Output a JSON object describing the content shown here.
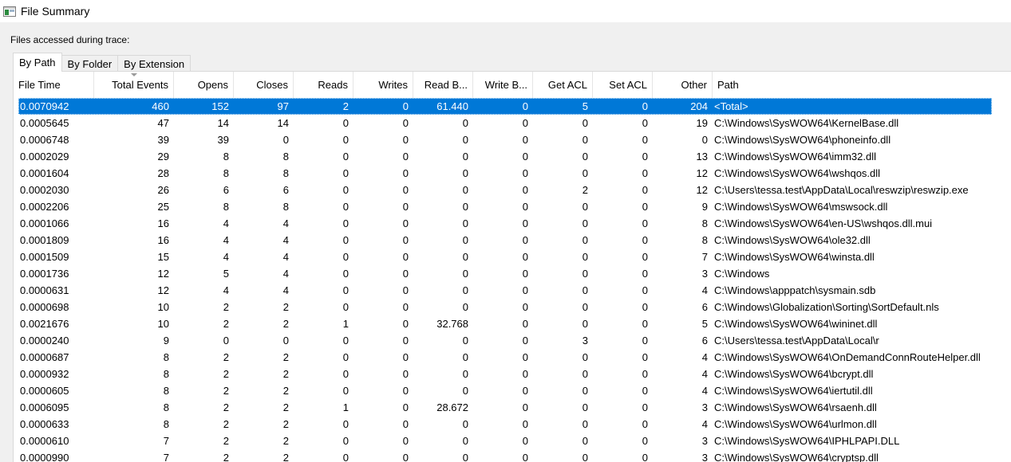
{
  "window": {
    "title": "File Summary",
    "icon": "window-app-icon"
  },
  "caption": "Files accessed during trace:",
  "tabs": [
    {
      "label": "By Path",
      "active": true
    },
    {
      "label": "By Folder",
      "active": false
    },
    {
      "label": "By Extension",
      "active": false
    }
  ],
  "columns": [
    "File Time",
    "Total Events",
    "Opens",
    "Closes",
    "Reads",
    "Writes",
    "Read B...",
    "Write B...",
    "Get ACL",
    "Set ACL",
    "Other",
    "Path"
  ],
  "colors": {
    "selection": "#0078d7"
  },
  "rows": [
    [
      "0.0070942",
      "460",
      "152",
      "97",
      "2",
      "0",
      "61.440",
      "0",
      "5",
      "0",
      "204",
      "<Total>"
    ],
    [
      "0.0005645",
      "47",
      "14",
      "14",
      "0",
      "0",
      "0",
      "0",
      "0",
      "0",
      "19",
      "C:\\Windows\\SysWOW64\\KernelBase.dll"
    ],
    [
      "0.0006748",
      "39",
      "39",
      "0",
      "0",
      "0",
      "0",
      "0",
      "0",
      "0",
      "0",
      "C:\\Windows\\SysWOW64\\phoneinfo.dll"
    ],
    [
      "0.0002029",
      "29",
      "8",
      "8",
      "0",
      "0",
      "0",
      "0",
      "0",
      "0",
      "13",
      "C:\\Windows\\SysWOW64\\imm32.dll"
    ],
    [
      "0.0001604",
      "28",
      "8",
      "8",
      "0",
      "0",
      "0",
      "0",
      "0",
      "0",
      "12",
      "C:\\Windows\\SysWOW64\\wshqos.dll"
    ],
    [
      "0.0002030",
      "26",
      "6",
      "6",
      "0",
      "0",
      "0",
      "0",
      "2",
      "0",
      "12",
      "C:\\Users\\tessa.test\\AppData\\Local\\reswzip\\reswzip.exe"
    ],
    [
      "0.0002206",
      "25",
      "8",
      "8",
      "0",
      "0",
      "0",
      "0",
      "0",
      "0",
      "9",
      "C:\\Windows\\SysWOW64\\mswsock.dll"
    ],
    [
      "0.0001066",
      "16",
      "4",
      "4",
      "0",
      "0",
      "0",
      "0",
      "0",
      "0",
      "8",
      "C:\\Windows\\SysWOW64\\en-US\\wshqos.dll.mui"
    ],
    [
      "0.0001809",
      "16",
      "4",
      "4",
      "0",
      "0",
      "0",
      "0",
      "0",
      "0",
      "8",
      "C:\\Windows\\SysWOW64\\ole32.dll"
    ],
    [
      "0.0001509",
      "15",
      "4",
      "4",
      "0",
      "0",
      "0",
      "0",
      "0",
      "0",
      "7",
      "C:\\Windows\\SysWOW64\\winsta.dll"
    ],
    [
      "0.0001736",
      "12",
      "5",
      "4",
      "0",
      "0",
      "0",
      "0",
      "0",
      "0",
      "3",
      "C:\\Windows"
    ],
    [
      "0.0000631",
      "12",
      "4",
      "4",
      "0",
      "0",
      "0",
      "0",
      "0",
      "0",
      "4",
      "C:\\Windows\\apppatch\\sysmain.sdb"
    ],
    [
      "0.0000698",
      "10",
      "2",
      "2",
      "0",
      "0",
      "0",
      "0",
      "0",
      "0",
      "6",
      "C:\\Windows\\Globalization\\Sorting\\SortDefault.nls"
    ],
    [
      "0.0021676",
      "10",
      "2",
      "2",
      "1",
      "0",
      "32.768",
      "0",
      "0",
      "0",
      "5",
      "C:\\Windows\\SysWOW64\\wininet.dll"
    ],
    [
      "0.0000240",
      "9",
      "0",
      "0",
      "0",
      "0",
      "0",
      "0",
      "3",
      "0",
      "6",
      "C:\\Users\\tessa.test\\AppData\\Local\\r"
    ],
    [
      "0.0000687",
      "8",
      "2",
      "2",
      "0",
      "0",
      "0",
      "0",
      "0",
      "0",
      "4",
      "C:\\Windows\\SysWOW64\\OnDemandConnRouteHelper.dll"
    ],
    [
      "0.0000932",
      "8",
      "2",
      "2",
      "0",
      "0",
      "0",
      "0",
      "0",
      "0",
      "4",
      "C:\\Windows\\SysWOW64\\bcrypt.dll"
    ],
    [
      "0.0000605",
      "8",
      "2",
      "2",
      "0",
      "0",
      "0",
      "0",
      "0",
      "0",
      "4",
      "C:\\Windows\\SysWOW64\\iertutil.dll"
    ],
    [
      "0.0006095",
      "8",
      "2",
      "2",
      "1",
      "0",
      "28.672",
      "0",
      "0",
      "0",
      "3",
      "C:\\Windows\\SysWOW64\\rsaenh.dll"
    ],
    [
      "0.0000633",
      "8",
      "2",
      "2",
      "0",
      "0",
      "0",
      "0",
      "0",
      "0",
      "4",
      "C:\\Windows\\SysWOW64\\urlmon.dll"
    ],
    [
      "0.0000610",
      "7",
      "2",
      "2",
      "0",
      "0",
      "0",
      "0",
      "0",
      "0",
      "3",
      "C:\\Windows\\SysWOW64\\IPHLPAPI.DLL"
    ],
    [
      "0.0000990",
      "7",
      "2",
      "2",
      "0",
      "0",
      "0",
      "0",
      "0",
      "0",
      "3",
      "C:\\Windows\\SysWOW64\\cryptsp.dll"
    ]
  ]
}
